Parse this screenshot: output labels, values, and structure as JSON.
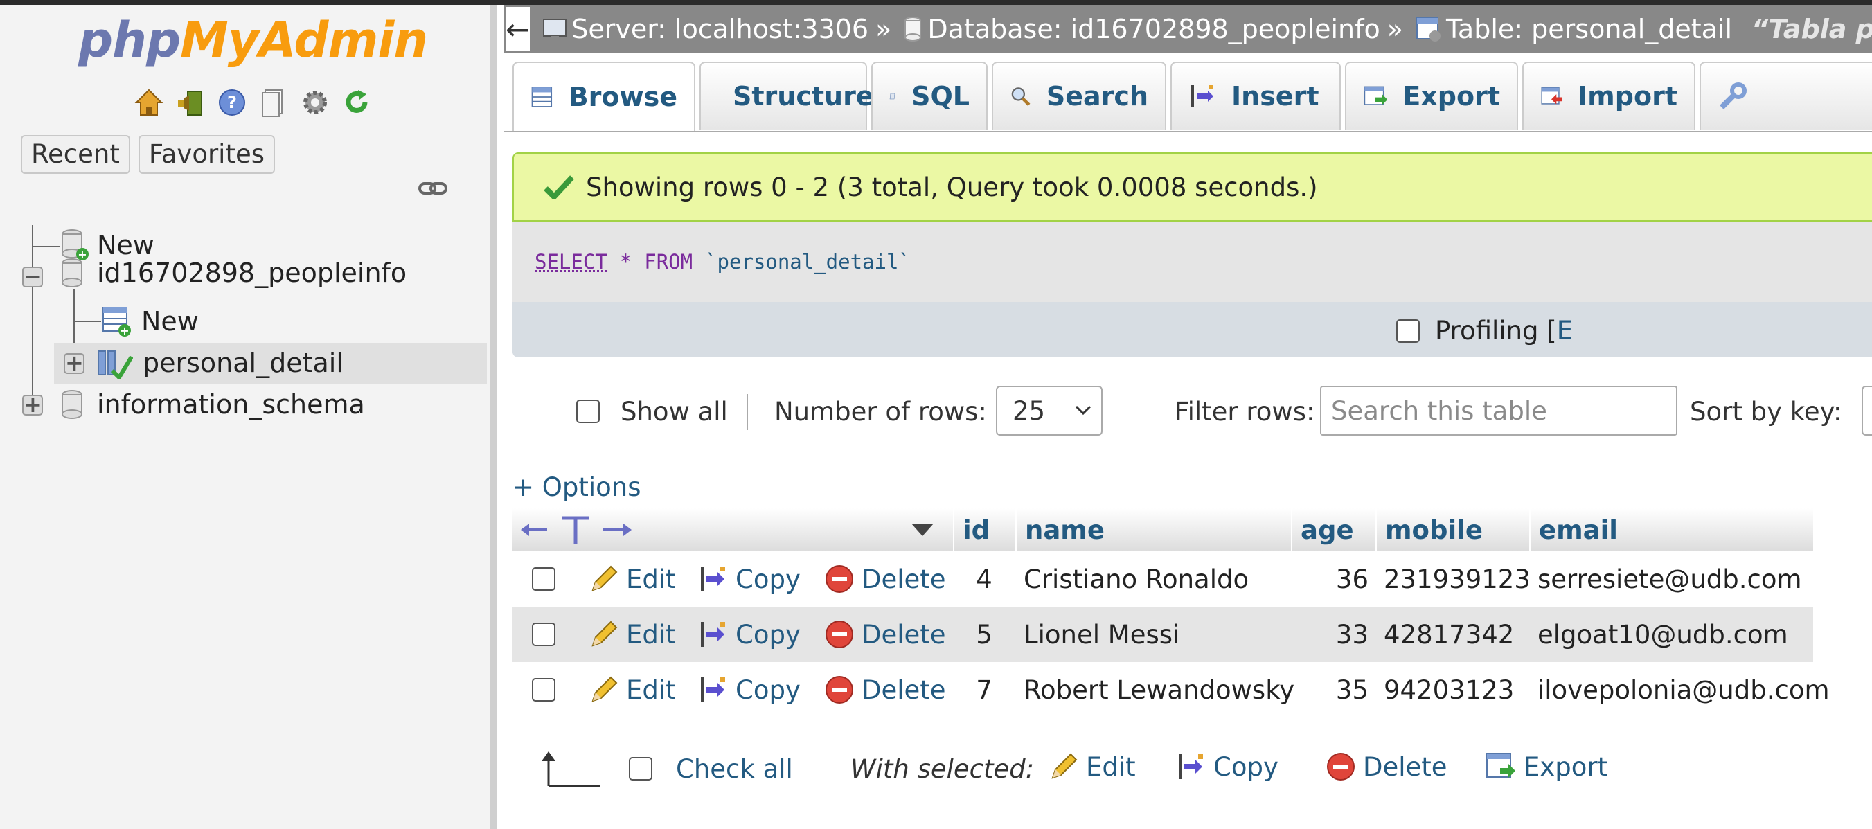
{
  "nav": {
    "logo_php": "php",
    "logo_myadmin": "MyAdmin",
    "tabs": [
      "Recent",
      "Favorites"
    ],
    "tree": {
      "new_root": "New",
      "db1": "id16702898_peopleinfo",
      "db1_new": "New",
      "db1_table": "personal_detail",
      "db2": "information_schema"
    }
  },
  "breadcrumb": {
    "back": "←",
    "server": "Server: localhost:3306",
    "database": "Database: id16702898_peopleinfo",
    "table": "Table: personal_detail",
    "comment": "“Tabla para r",
    "sep": "»"
  },
  "tabs": [
    "Browse",
    "Structure",
    "SQL",
    "Search",
    "Insert",
    "Export",
    "Import"
  ],
  "message": "Showing rows 0 - 2 (3 total, Query took 0.0008 seconds.)",
  "sql": {
    "select": "SELECT",
    "star": "*",
    "from": "FROM",
    "table": "`personal_detail`"
  },
  "profiling": {
    "label": "Profiling [",
    "edit_inline": "E"
  },
  "controls": {
    "show_all": "Show all",
    "number_of_rows_label": "Number of rows:",
    "number_of_rows_value": "25",
    "filter_label": "Filter rows:",
    "filter_placeholder": "Search this table",
    "sort_label": "Sort by key:"
  },
  "options_link": "+ Options",
  "table": {
    "columns": [
      "id",
      "name",
      "age",
      "mobile",
      "email"
    ],
    "actions": {
      "edit": "Edit",
      "copy": "Copy",
      "delete": "Delete"
    },
    "rows": [
      {
        "id": "4",
        "name": "Cristiano Ronaldo",
        "age": "36",
        "mobile": "231939123",
        "email": "serresiete@udb.com"
      },
      {
        "id": "5",
        "name": "Lionel Messi",
        "age": "33",
        "mobile": "42817342",
        "email": "elgoat10@udb.com"
      },
      {
        "id": "7",
        "name": "Robert Lewandowsky",
        "age": "35",
        "mobile": "94203123",
        "email": "ilovepolonia@udb.com"
      }
    ]
  },
  "bottom": {
    "check_all": "Check all",
    "with_selected": "With selected:",
    "edit": "Edit",
    "copy": "Copy",
    "delete": "Delete",
    "export": "Export"
  },
  "colors": {
    "link": "#235a81",
    "success_bg": "#ebf8a4",
    "breadcrumb_bg": "#888888",
    "logo_blue": "#6c78af",
    "logo_orange": "#f89c0e"
  }
}
